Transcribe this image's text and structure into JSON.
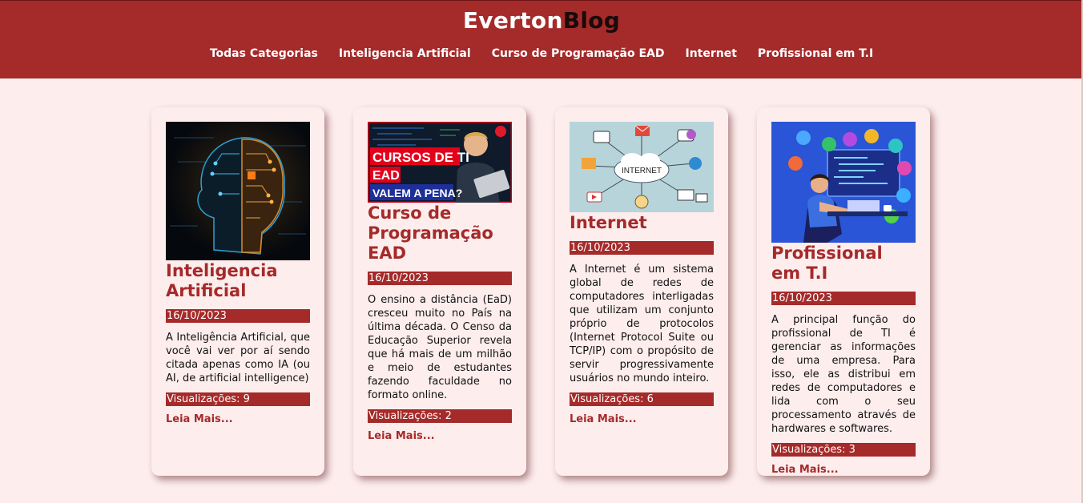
{
  "brand": {
    "part1": "Everton",
    "part2": "Blog"
  },
  "nav": [
    "Todas Categorias",
    "Inteligencia Artificial",
    "Curso de Programação EAD",
    "Internet",
    "Profissional em T.I"
  ],
  "cards": [
    {
      "title": "Inteligencia Artificial",
      "image": "ai-head-circuit-image",
      "date": "16/10/2023",
      "description": "A Inteligência Artificial, que você vai ver por aí sendo citada apenas como IA (ou AI, de artificial intelligence)",
      "views": "Visualizações: 9",
      "link": "Leia Mais..."
    },
    {
      "title": "Curso de Programação EAD",
      "image": "cursos-de-ti-thumbnail-image",
      "image_text": {
        "line1": "CURSOS DE TI",
        "line2": "EAD",
        "line3": "VALEM A PENA?"
      },
      "date": "16/10/2023",
      "description": "O ensino a distância (EaD) cresceu muito no País na última década. O Censo da Educação Superior revela que há mais de um milhão e meio de estudantes fazendo faculdade no formato online.",
      "views": "Visualizações: 2",
      "link": "Leia Mais..."
    },
    {
      "title": "Internet",
      "image": "internet-network-diagram-image",
      "image_text": {
        "cloud": "INTERNET"
      },
      "date": "16/10/2023",
      "description": "A Internet é um sistema global de redes de computadores interligadas que utilizam um conjunto próprio de protocolos (Internet Protocol Suite ou TCP/IP) com o propósito de servir progressivamente usuários no mundo inteiro.",
      "views": "Visualizações: 6",
      "link": "Leia Mais..."
    },
    {
      "title": "Profissional em T.I",
      "image": "developer-at-desk-image",
      "date": "16/10/2023",
      "description": "A principal função do profissional de TI é gerenciar as informações de uma empresa. Para isso, ele as distribui em redes de computadores e lida com o seu processamento através de hardwares e softwares.",
      "views": "Visualizações: 3",
      "link": "Leia Mais..."
    }
  ],
  "colors": {
    "primary": "#a52a2a",
    "background": "#fdeded",
    "brand_dark": "#1a0a0a"
  }
}
